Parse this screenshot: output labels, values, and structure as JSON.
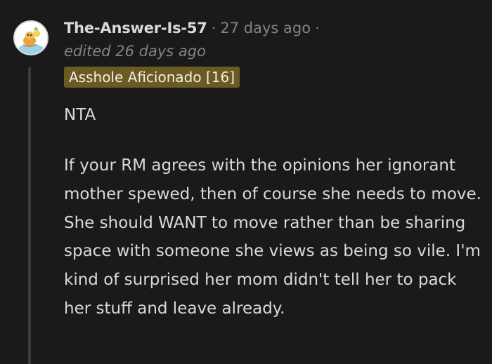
{
  "comment": {
    "username": "The-Answer-Is-57",
    "separator": "·",
    "timestamp": "27 days ago",
    "trailing_separator": "·",
    "edited": "edited 26 days ago",
    "flair": "Asshole Aficionado [16]",
    "verdict": "NTA",
    "body": "If your RM agrees with the opinions her ignorant mother spewed, then of course she needs to move. She should WANT to move rather than be sharing space with someone she views as being so vile. I'm kind of surprised her mom didn't tell her to pack her stuff and leave already."
  },
  "avatar": {
    "icon": "snoo-avatar-icon"
  },
  "colors": {
    "background": "#1a1a1b",
    "text": "#d7dadc",
    "muted": "#818384",
    "flair_bg": "#6b5a22",
    "thread_line": "#3a3a3c"
  }
}
